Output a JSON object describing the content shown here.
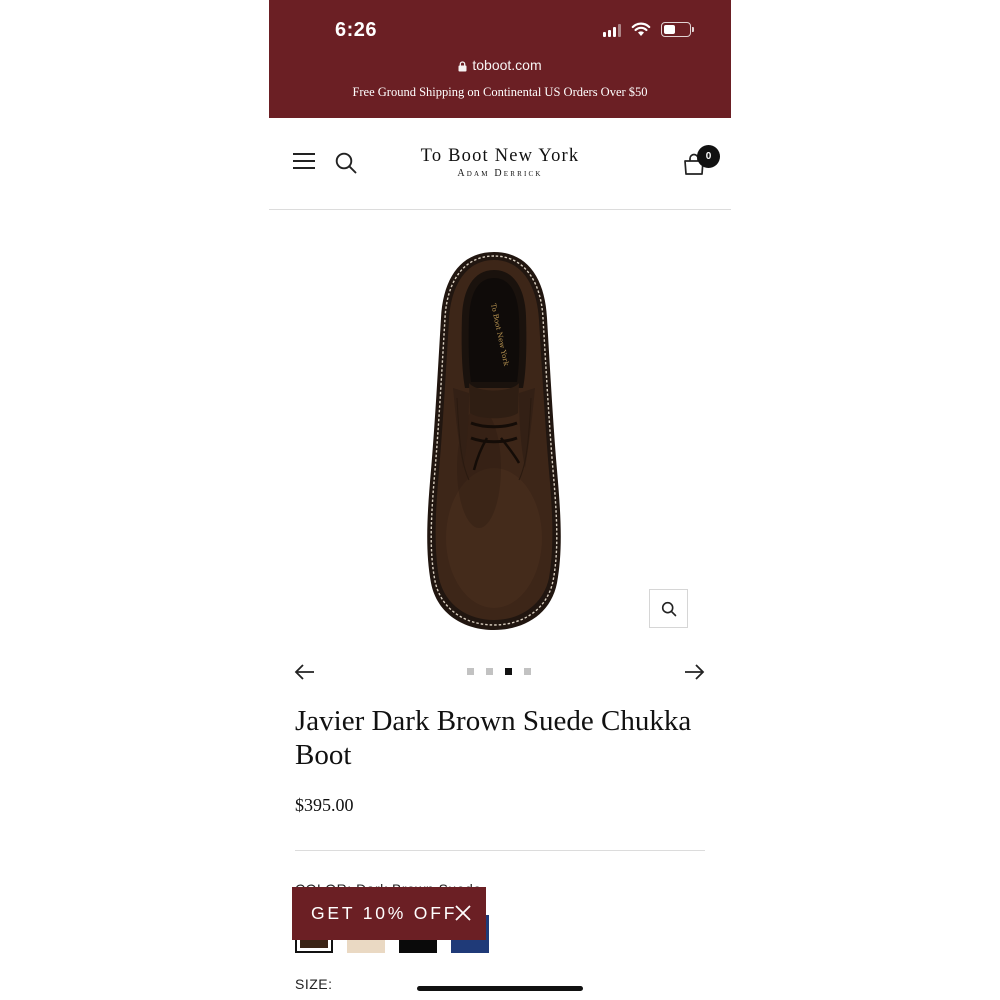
{
  "status_bar": {
    "time": "6:26",
    "battery_level": 0.45
  },
  "browser": {
    "url": "toboot.com"
  },
  "promo_banner": {
    "text": "Free Ground Shipping on Continental US Orders Over $50"
  },
  "header": {
    "logo_main": "To Boot New York",
    "logo_sub": "Adam Derrick",
    "cart_count": "0"
  },
  "product": {
    "title": "Javier Dark Brown Suede Chukka Boot",
    "price": "$395.00",
    "color_label": "COLOR: Dark Brown Suede",
    "size_label": "SIZE:",
    "insole_text": "To Boot New York",
    "image_count": 4,
    "active_image": 3,
    "swatches": [
      {
        "name": "Dark Brown Suede",
        "color": "#3b2416",
        "selected": true
      },
      {
        "name": "Light Tan",
        "color": "#ead9c3",
        "selected": false
      },
      {
        "name": "Black",
        "color": "#0a0a0a",
        "selected": false
      },
      {
        "name": "Navy",
        "color": "#1f3a78",
        "selected": false
      }
    ]
  },
  "discount_popup": {
    "label": "GET 10% OFF"
  },
  "colors": {
    "brand_maroon": "#6b1f24",
    "text": "#111111"
  }
}
